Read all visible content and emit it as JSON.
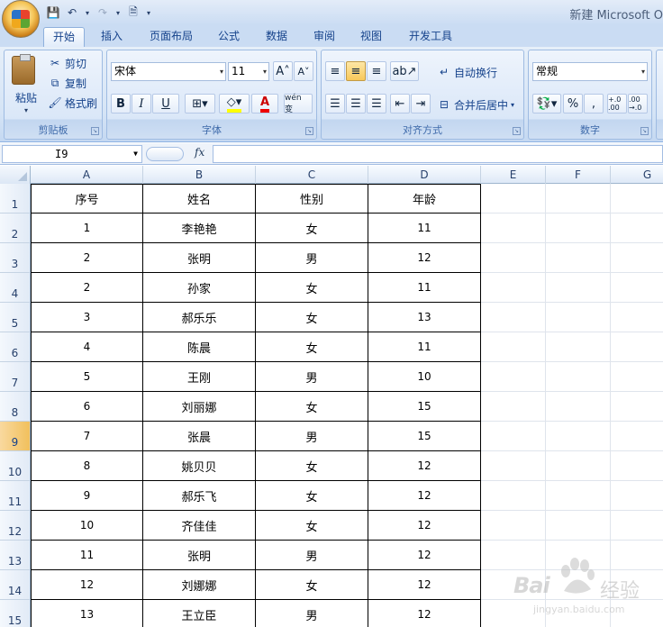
{
  "window": {
    "title": "新建 Microsoft O"
  },
  "tabs": [
    "开始",
    "插入",
    "页面布局",
    "公式",
    "数据",
    "审阅",
    "视图",
    "开发工具"
  ],
  "active_tab": 0,
  "ribbon": {
    "clipboard": {
      "label": "剪贴板",
      "paste": "粘贴",
      "cut": "剪切",
      "copy": "复制",
      "format_painter": "格式刷"
    },
    "font": {
      "label": "字体",
      "font_name": "宋体",
      "font_size": "11",
      "bold": "B",
      "italic": "I",
      "underline": "U",
      "font_color_glyph": "A",
      "phonetic": "wén 变"
    },
    "alignment": {
      "label": "对齐方式",
      "wrap_text": "自动换行",
      "merge_center": "合并后居中"
    },
    "number": {
      "label": "数字",
      "format": "常规",
      "percent": "%",
      "inc_dec_1": "+.0 .00",
      "inc_dec_2": ".00 →.0"
    }
  },
  "formula_bar": {
    "name_box": "I9",
    "fx": "fx",
    "formula": ""
  },
  "sheet": {
    "columns": [
      "A",
      "B",
      "C",
      "D",
      "E",
      "F",
      "G"
    ],
    "rows": [
      "1",
      "2",
      "3",
      "4",
      "5",
      "6",
      "7",
      "8",
      "9",
      "10",
      "11",
      "12",
      "13",
      "14",
      "15"
    ],
    "selected_row": "9",
    "header": [
      "序号",
      "姓名",
      "性别",
      "年龄"
    ],
    "data": [
      [
        "1",
        "李艳艳",
        "女",
        "11"
      ],
      [
        "2",
        "张明",
        "男",
        "12"
      ],
      [
        "2",
        "孙家",
        "女",
        "11"
      ],
      [
        "3",
        "郝乐乐",
        "女",
        "13"
      ],
      [
        "4",
        "陈晨",
        "女",
        "11"
      ],
      [
        "5",
        "王刚",
        "男",
        "10"
      ],
      [
        "6",
        "刘丽娜",
        "女",
        "15"
      ],
      [
        "7",
        "张晨",
        "男",
        "15"
      ],
      [
        "8",
        "姚贝贝",
        "女",
        "12"
      ],
      [
        "9",
        "郝乐飞",
        "女",
        "12"
      ],
      [
        "10",
        "齐佳佳",
        "女",
        "12"
      ],
      [
        "11",
        "张明",
        "男",
        "12"
      ],
      [
        "12",
        "刘娜娜",
        "女",
        "12"
      ],
      [
        "13",
        "王立臣",
        "男",
        "12"
      ]
    ]
  },
  "watermark": {
    "brand": "Bai",
    "brand2": "经验",
    "url": "jingyan.baidu.com"
  }
}
